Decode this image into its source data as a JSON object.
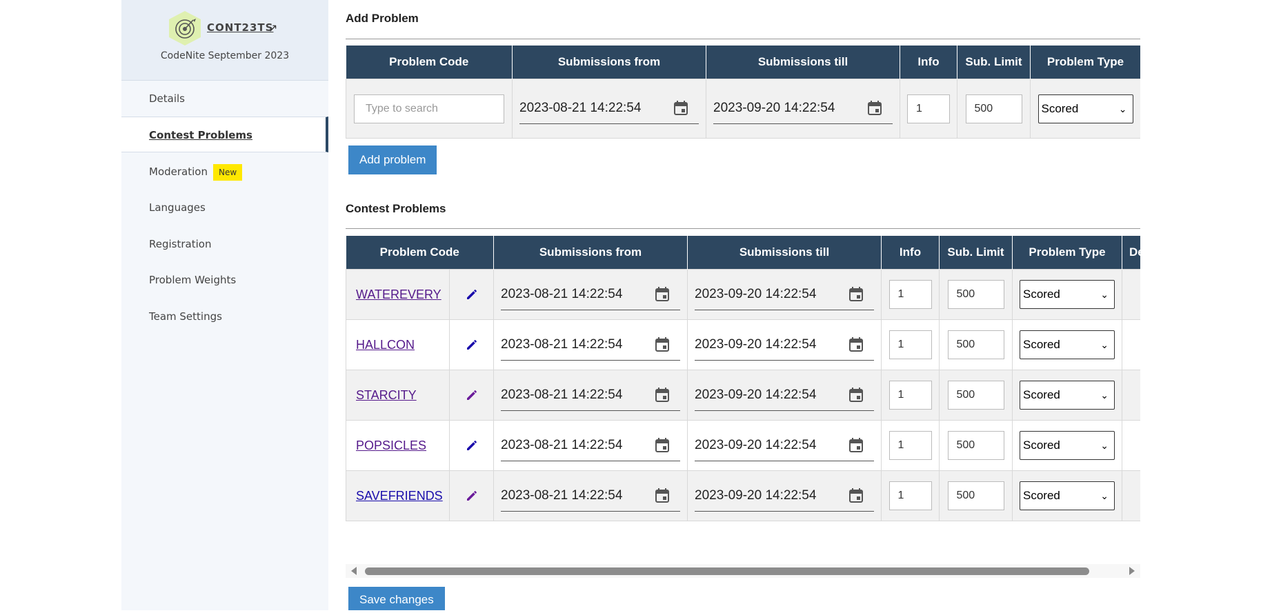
{
  "sidebar": {
    "contest_code": "CONT23TS",
    "ext_icon": "↗",
    "contest_name": "CodeNite September 2023",
    "items": [
      {
        "label": "Details"
      },
      {
        "label": "Contest Problems"
      },
      {
        "label": "Moderation",
        "badge": "New"
      },
      {
        "label": "Languages"
      },
      {
        "label": "Registration"
      },
      {
        "label": "Problem Weights"
      },
      {
        "label": "Team Settings"
      }
    ]
  },
  "add_problem": {
    "title": "Add Problem",
    "headers": [
      "Problem Code",
      "Submissions from",
      "Submissions till",
      "Info",
      "Sub. Limit",
      "Problem Type"
    ],
    "search_placeholder": "Type to search",
    "from": "2023-08-21 14:22:54",
    "till": "2023-09-20 14:22:54",
    "info": "1",
    "sub_limit": "500",
    "type": "Scored",
    "button": "Add problem"
  },
  "contest_problems": {
    "title": "Contest Problems",
    "headers": [
      "Problem Code",
      "Submissions from",
      "Submissions till",
      "Info",
      "Sub. Limit",
      "Problem Type",
      "De"
    ],
    "rows": [
      {
        "code": "WATEREVERY",
        "from": "2023-08-21 14:22:54",
        "till": "2023-09-20 14:22:54",
        "info": "1",
        "sub_limit": "500",
        "type": "Scored"
      },
      {
        "code": "HALLCON",
        "from": "2023-08-21 14:22:54",
        "till": "2023-09-20 14:22:54",
        "info": "1",
        "sub_limit": "500",
        "type": "Scored"
      },
      {
        "code": "STARCITY",
        "from": "2023-08-21 14:22:54",
        "till": "2023-09-20 14:22:54",
        "info": "1",
        "sub_limit": "500",
        "type": "Scored"
      },
      {
        "code": "POPSICLES",
        "from": "2023-08-21 14:22:54",
        "till": "2023-09-20 14:22:54",
        "info": "1",
        "sub_limit": "500",
        "type": "Scored"
      },
      {
        "code": "SAVEFRIENDS",
        "from": "2023-08-21 14:22:54",
        "till": "2023-09-20 14:22:54",
        "info": "1",
        "sub_limit": "500",
        "type": "Scored"
      }
    ],
    "save_button": "Save changes"
  },
  "colors": {
    "header_bg": "#2d4760",
    "button_bg": "#3d87c8",
    "badge_bg": "#ffe800",
    "sidebar_active_border": "#2d4a66"
  }
}
